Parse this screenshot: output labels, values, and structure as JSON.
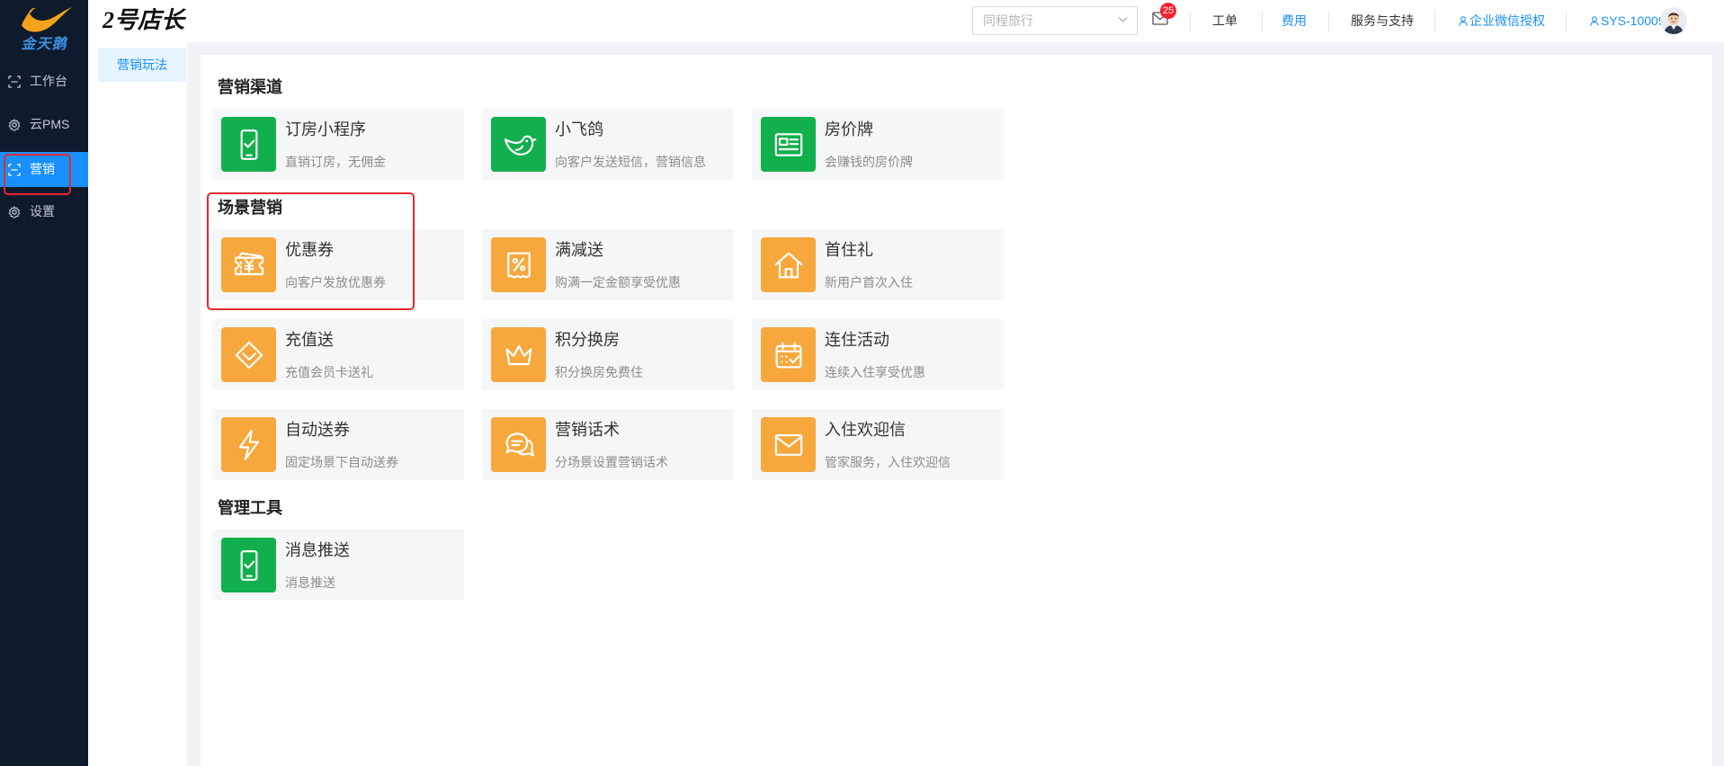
{
  "sidebar": {
    "logo_text": "金天鹅",
    "items": [
      {
        "label": "工作台",
        "icon": "scan-icon",
        "active": false
      },
      {
        "label": "云PMS",
        "icon": "gear-icon",
        "active": false
      },
      {
        "label": "营销",
        "icon": "scan-icon",
        "active": true
      },
      {
        "label": "设置",
        "icon": "gear-icon",
        "active": false
      }
    ]
  },
  "header": {
    "title": "2号店长",
    "hotel_select": {
      "placeholder": "同程旅行"
    },
    "mail_badge": "25",
    "nav": [
      {
        "label": "工单"
      },
      {
        "label": "费用"
      },
      {
        "label": "服务与支持"
      }
    ],
    "wechat_auth": "企业微信授权",
    "user": "SYS-10009"
  },
  "subnav": {
    "items": [
      {
        "label": "营销玩法",
        "active": true
      }
    ]
  },
  "main": {
    "sections": [
      {
        "title": "营销渠道",
        "cards": [
          {
            "title": "订房小程序",
            "subtitle": "直销订房，无佣金",
            "icon": "phone-check-icon",
            "color": "green"
          },
          {
            "title": "小飞鸽",
            "subtitle": "向客户发送短信，营销信息",
            "icon": "bird-icon",
            "color": "green"
          },
          {
            "title": "房价牌",
            "subtitle": "会赚钱的房价牌",
            "icon": "price-board-icon",
            "color": "green"
          }
        ]
      },
      {
        "title": "场景营销",
        "cards": [
          {
            "title": "优惠券",
            "subtitle": "向客户发放优惠券",
            "icon": "coupon-icon",
            "color": "orange"
          },
          {
            "title": "满减送",
            "subtitle": "购满一定金额享受优惠",
            "icon": "percent-ticket-icon",
            "color": "orange"
          },
          {
            "title": "首住礼",
            "subtitle": "新用户首次入住",
            "icon": "house-icon",
            "color": "orange"
          },
          {
            "title": "充值送",
            "subtitle": "充值会员卡送礼",
            "icon": "diamond-icon",
            "color": "orange"
          },
          {
            "title": "积分换房",
            "subtitle": "积分换房免费住",
            "icon": "crown-icon",
            "color": "orange"
          },
          {
            "title": "连住活动",
            "subtitle": "连续入住享受优惠",
            "icon": "calendar-check-icon",
            "color": "orange"
          },
          {
            "title": "自动送券",
            "subtitle": "固定场景下自动送券",
            "icon": "lightning-icon",
            "color": "orange"
          },
          {
            "title": "营销话术",
            "subtitle": "分场景设置营销话术",
            "icon": "chat-bubbles-icon",
            "color": "orange"
          },
          {
            "title": "入住欢迎信",
            "subtitle": "管家服务，入住欢迎信",
            "icon": "envelope-icon",
            "color": "orange"
          }
        ]
      },
      {
        "title": "管理工具",
        "cards": [
          {
            "title": "消息推送",
            "subtitle": "消息推送",
            "icon": "phone-check-icon",
            "color": "green"
          }
        ]
      }
    ]
  },
  "colors": {
    "green": "#12b04c",
    "orange": "#f7a83c",
    "accent": "#1890ff",
    "sidebar_bg": "#0e1b2c",
    "highlight": "#e5282f"
  }
}
